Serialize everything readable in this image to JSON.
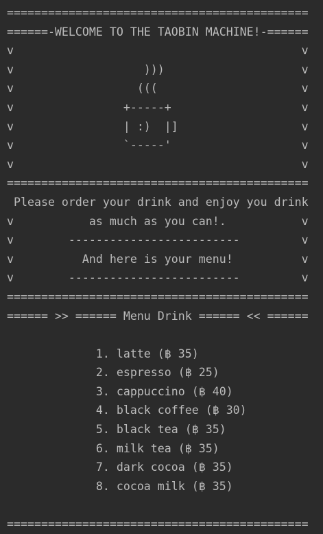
{
  "console": {
    "lines": [
      "============================================",
      "======-WELCOME TO THE TAOBIN MACHINE!-======",
      "v                                          v",
      "v                   )))                    v",
      "v                  (((                     v",
      "v                +-----+                   v",
      "v                | :)  |]                  v",
      "v                `-----'                   v",
      "v                                          v",
      "============================================",
      " Please order your drink and enjoy you drink",
      "v           as much as you can!.           v",
      "v        -------------------------         v",
      "v          And here is your menu!          v",
      "v        -------------------------         v",
      "============================================",
      "====== >> ====== Menu Drink ====== << ======",
      "",
      "             1. latte (฿ 35)",
      "             2. espresso (฿ 25)",
      "             3. cappuccino (฿ 40)",
      "             4. black coffee (฿ 30)",
      "             5. black tea (฿ 35)",
      "             6. milk tea (฿ 35)",
      "             7. dark cocoa (฿ 35)",
      "             8. cocoa milk (฿ 35)",
      "",
      "============================================"
    ]
  }
}
